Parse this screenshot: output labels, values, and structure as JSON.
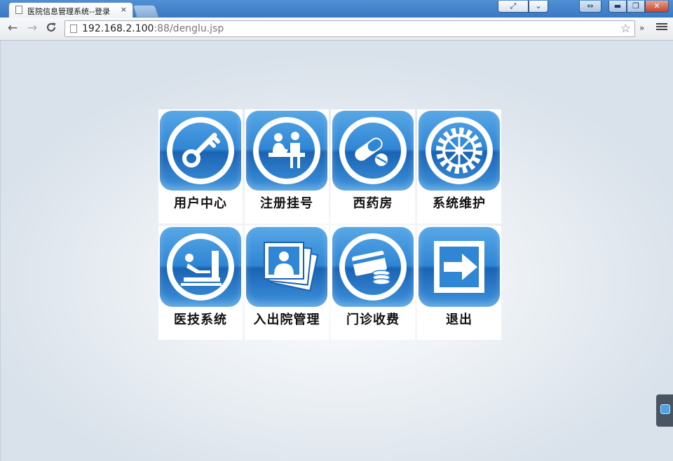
{
  "browser": {
    "tab_title": "医院信息管理系统--登录",
    "tab_close": "×",
    "url_host": "192.168.2.100",
    "url_rest": ":88/denglu.jsp",
    "ext_label": "»",
    "star": "☆",
    "back": "←",
    "forward": "→",
    "reload": "C",
    "win_min": "▬",
    "win_max": "❐",
    "win_close": "✕",
    "fullscreen": "⤢",
    "tabmenu": "⌄",
    "user": "⇔"
  },
  "menu": {
    "tiles": [
      {
        "label": "用户中心",
        "icon": "key-icon"
      },
      {
        "label": "注册挂号",
        "icon": "registration-icon"
      },
      {
        "label": "西药房",
        "icon": "pills-icon"
      },
      {
        "label": "系统维护",
        "icon": "gear-icon"
      },
      {
        "label": "医技系统",
        "icon": "medical-tech-icon"
      },
      {
        "label": "入出院管理",
        "icon": "photos-icon"
      },
      {
        "label": "门诊收费",
        "icon": "payment-card-icon"
      },
      {
        "label": "退出",
        "icon": "exit-arrow-icon"
      }
    ]
  },
  "colors": {
    "tile_blue_top": "#58a7e6",
    "tile_blue_dark": "#1a63b4",
    "label_text": "#111111"
  }
}
